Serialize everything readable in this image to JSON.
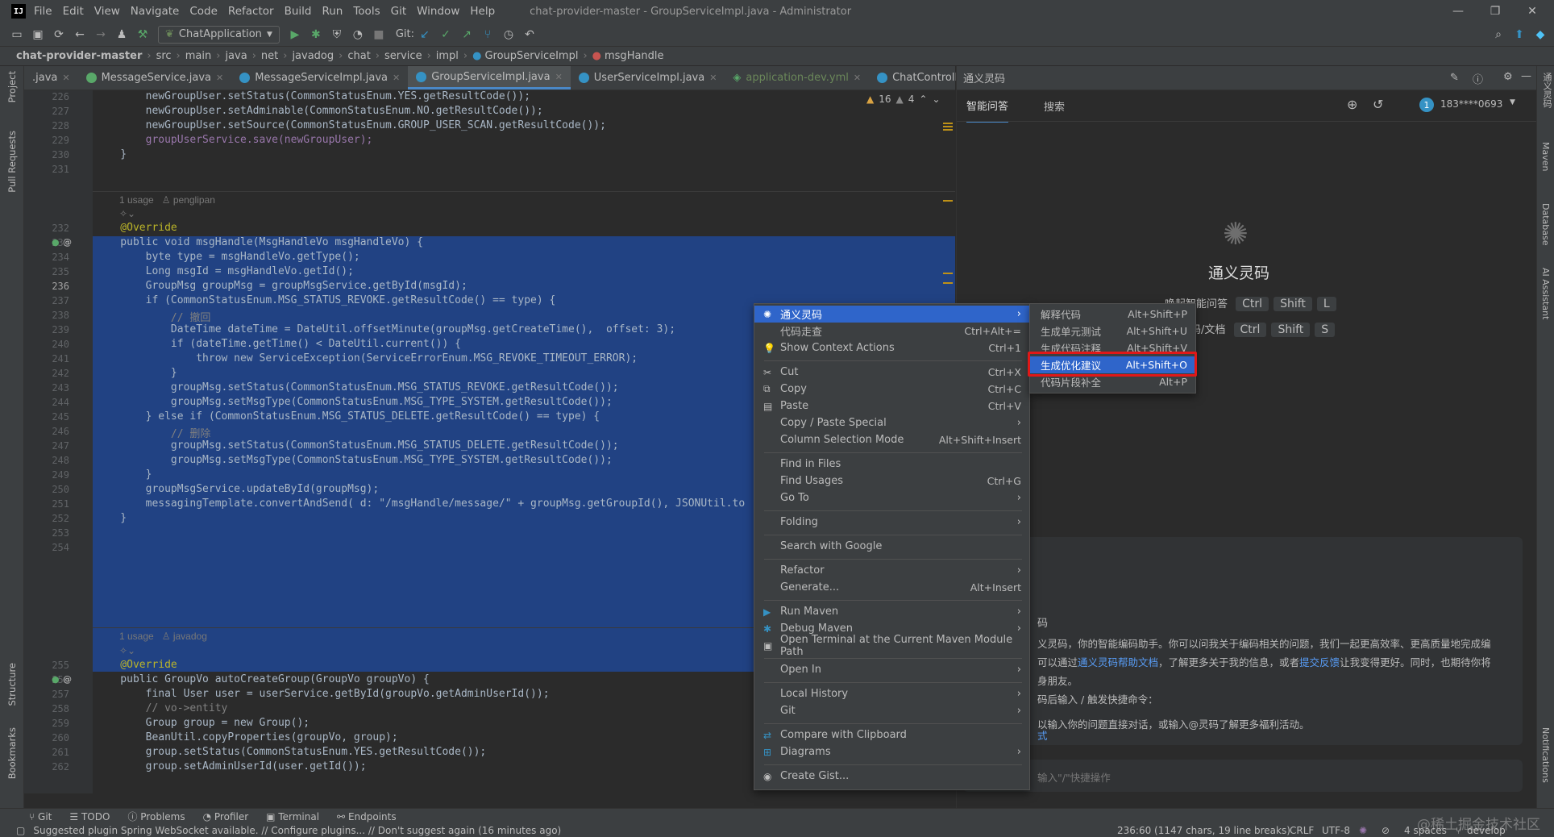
{
  "menu": {
    "items": [
      "File",
      "Edit",
      "View",
      "Navigate",
      "Code",
      "Refactor",
      "Build",
      "Run",
      "Tools",
      "Git",
      "Window",
      "Help"
    ],
    "title": "chat-provider-master - GroupServiceImpl.java - Administrator"
  },
  "toolbar": {
    "run_config": "ChatApplication",
    "git_label": "Git:"
  },
  "breadcrumb": [
    "chat-provider-master",
    "src",
    "main",
    "java",
    "net",
    "javadog",
    "chat",
    "service",
    "impl",
    "GroupServiceImpl",
    "msgHandle"
  ],
  "tabs": [
    {
      "label": ".java"
    },
    {
      "label": "MessageService.java"
    },
    {
      "label": "MessageServiceImpl.java"
    },
    {
      "label": "GroupServiceImpl.java",
      "active": true
    },
    {
      "label": "UserServiceImpl.java"
    },
    {
      "label": "application-dev.yml"
    },
    {
      "label": "ChatController.java"
    }
  ],
  "inspections": {
    "warnings": "16",
    "weak": "4"
  },
  "left_tools": {
    "project": "Project",
    "pull_requests": "Pull Requests",
    "structure": "Structure",
    "bookmarks": "Bookmarks"
  },
  "right_tools": {
    "tongyi": "通义灵码",
    "maven": "Maven",
    "database": "Database",
    "ai_assistant": "AI Assistant",
    "notifications": "Notifications"
  },
  "code": {
    "l226": "        newGroupUser.setStatus(CommonStatusEnum.YES.getResultCode());",
    "l227": "        newGroupUser.setAdminable(CommonStatusEnum.NO.getResultCode());",
    "l228": "        newGroupUser.setSource(CommonStatusEnum.GROUP_USER_SCAN.getResultCode());",
    "l229": "        groupUserService.save(newGroupUser);",
    "l230": "    }",
    "usage1": "1 usage",
    "author1": "penglipan",
    "l232": "    @Override",
    "l233": "    public void msgHandle(MsgHandleVo msgHandleVo) {",
    "l234": "        byte type = msgHandleVo.getType();",
    "l235": "        Long msgId = msgHandleVo.getId();",
    "l236": "        GroupMsg groupMsg = groupMsgService.getById(msgId);",
    "l237": "        if (CommonStatusEnum.MSG_STATUS_REVOKE.getResultCode() == type) {",
    "l238": "            // 撤回",
    "l239": "            DateTime dateTime = DateUtil.offsetMinute(groupMsg.getCreateTime(),  offset: 3);",
    "l240": "            if (dateTime.getTime() < DateUtil.current()) {",
    "l241": "                throw new ServiceException(ServiceErrorEnum.MSG_REVOKE_TIMEOUT_ERROR);",
    "l242": "            }",
    "l243": "            groupMsg.setStatus(CommonStatusEnum.MSG_STATUS_REVOKE.getResultCode());",
    "l244": "            groupMsg.setMsgType(CommonStatusEnum.MSG_TYPE_SYSTEM.getResultCode());",
    "l245": "        } else if (CommonStatusEnum.MSG_STATUS_DELETE.getResultCode() == type) {",
    "l246": "            // 删除",
    "l247": "            groupMsg.setStatus(CommonStatusEnum.MSG_STATUS_DELETE.getResultCode());",
    "l248": "            groupMsg.setMsgType(CommonStatusEnum.MSG_TYPE_SYSTEM.getResultCode());",
    "l249": "        }",
    "l250": "        groupMsgService.updateById(groupMsg);",
    "l251": "        messagingTemplate.convertAndSend( d: \"/msgHandle/message/\" + groupMsg.getGroupId(), JSONUtil.to",
    "l252": "    }",
    "usage2": "1 usage",
    "author2": "javadog",
    "l255": "    @Override",
    "l256": "    public GroupVo autoCreateGroup(GroupVo groupVo) {",
    "l257": "        final User user = userService.getById(groupVo.getAdminUserId());",
    "l258": "        // vo->entity",
    "l259": "        Group group = new Group();",
    "l260": "        BeanUtil.copyProperties(groupVo, group);",
    "l261": "        group.setStatus(CommonStatusEnum.YES.getResultCode());",
    "l262": "        group.setAdminUserId(user.getId());"
  },
  "line_numbers": [
    "226",
    "227",
    "228",
    "229",
    "230",
    "231",
    "232",
    "233",
    "234",
    "235",
    "236",
    "237",
    "238",
    "239",
    "240",
    "241",
    "242",
    "243",
    "244",
    "245",
    "246",
    "247",
    "248",
    "249",
    "250",
    "251",
    "252",
    "253",
    "254",
    "255",
    "256",
    "257",
    "258",
    "259",
    "260",
    "261",
    "262"
  ],
  "context_menu": [
    {
      "label": "通义灵码",
      "submenu": true,
      "highlighted": true
    },
    {
      "label": "代码走查",
      "shortcut": "Ctrl+Alt+="
    },
    {
      "label": "Show Context Actions",
      "shortcut": "Ctrl+1"
    },
    {
      "label": "Cut",
      "shortcut": "Ctrl+X"
    },
    {
      "label": "Copy",
      "shortcut": "Ctrl+C"
    },
    {
      "label": "Paste",
      "shortcut": "Ctrl+V"
    },
    {
      "label": "Copy / Paste Special",
      "submenu": true
    },
    {
      "label": "Column Selection Mode",
      "shortcut": "Alt+Shift+Insert"
    },
    {
      "label": "Find in Files"
    },
    {
      "label": "Find Usages",
      "shortcut": "Ctrl+G"
    },
    {
      "label": "Go To",
      "submenu": true
    },
    {
      "label": "Folding",
      "submenu": true
    },
    {
      "label": "Search with Google"
    },
    {
      "label": "Refactor",
      "submenu": true
    },
    {
      "label": "Generate...",
      "shortcut": "Alt+Insert"
    },
    {
      "label": "Run Maven",
      "submenu": true
    },
    {
      "label": "Debug Maven",
      "submenu": true
    },
    {
      "label": "Open Terminal at the Current Maven Module Path"
    },
    {
      "label": "Open In",
      "submenu": true
    },
    {
      "label": "Local History",
      "submenu": true
    },
    {
      "label": "Git",
      "submenu": true
    },
    {
      "label": "Compare with Clipboard"
    },
    {
      "label": "Diagrams",
      "submenu": true
    },
    {
      "label": "Create Gist..."
    }
  ],
  "submenu": [
    {
      "label": "解释代码",
      "shortcut": "Alt+Shift+P"
    },
    {
      "label": "生成单元测试",
      "shortcut": "Alt+Shift+U"
    },
    {
      "label": "生成代码注释",
      "shortcut": "Alt+Shift+V"
    },
    {
      "label": "生成优化建议",
      "shortcut": "Alt+Shift+O",
      "highlighted": true
    },
    {
      "label": "代码片段补全",
      "shortcut": "Alt+P"
    }
  ],
  "right_panel": {
    "title": "通义灵码",
    "tabs": [
      "智能问答",
      "搜索"
    ],
    "user": "183****0693",
    "user_badge": "1",
    "brand": "通义灵码",
    "shortcut1_label": "唤起智能问答",
    "shortcut1_keys": [
      "Ctrl",
      "Shift",
      "L"
    ],
    "shortcut2_label": "码/文档",
    "shortcut2_keys": [
      "Ctrl",
      "Shift",
      "S"
    ],
    "welcome_l1": "码",
    "welcome_l2": "义灵码，你的智能编码助手。你可以问我关于编码相关的问题，我们一起更高效率、更高质量地完成编",
    "welcome_l3_a": "可以通过",
    "welcome_l3_link1": "通义灵码帮助文档",
    "welcome_l3_b": "，了解更多关于我的信息，或者",
    "welcome_l3_link2": "提交反馈",
    "welcome_l3_c": "让我变得更好。同时，也期待你将",
    "welcome_l4": "身朋友。",
    "welcome_l5": "码后输入 / 触发快捷命令：",
    "welcome_l6": "式",
    "welcome_l7": "以输入你的问题直接对话，或输入@灵码了解更多福利活动。",
    "input_placeholder": "输入\"/\"快捷操作"
  },
  "bottom_tools": [
    "Git",
    "TODO",
    "Problems",
    "Profiler",
    "Terminal",
    "Endpoints"
  ],
  "status": {
    "message": "Suggested plugin Spring WebSocket available. // Configure plugins... // Don't suggest again (16 minutes ago)",
    "position": "236:60 (1147 chars, 19 line breaks)",
    "line_sep": "CRLF",
    "encoding": "UTF-8",
    "indent": "4 spaces",
    "branch": "develop",
    "watermark": "@稀土掘金技术社区"
  }
}
